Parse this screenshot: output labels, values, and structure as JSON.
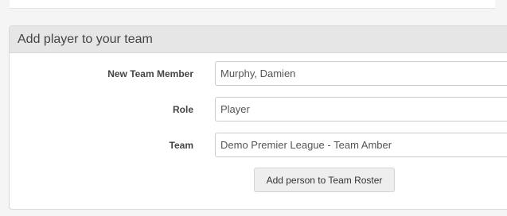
{
  "panel": {
    "title": "Add player to your team"
  },
  "form": {
    "member": {
      "label": "New Team Member",
      "value": "Murphy, Damien"
    },
    "role": {
      "label": "Role",
      "value": "Player"
    },
    "team": {
      "label": "Team",
      "value": "Demo Premier League - Team Amber"
    },
    "submit_label": "Add person to Team Roster"
  },
  "colors": {
    "panel_header_bg": "#e6e6e6",
    "page_bg": "#f5f5f5",
    "button_bg": "#eeeeee"
  }
}
